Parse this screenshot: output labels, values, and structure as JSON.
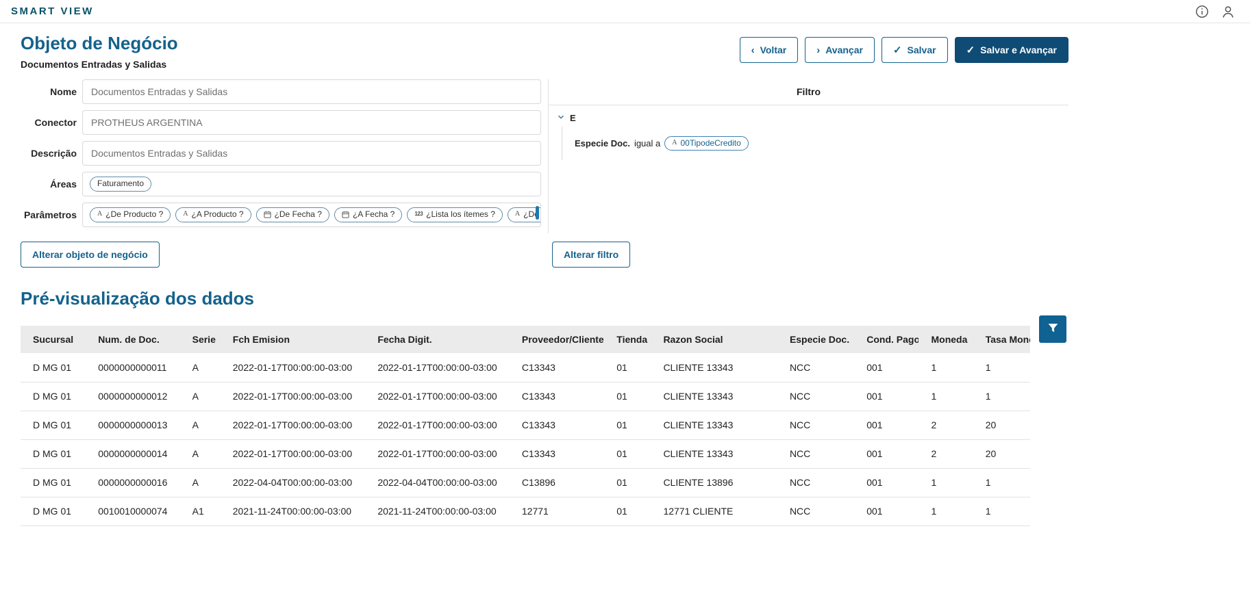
{
  "topbar": {
    "brand": "SMART VIEW",
    "icons": [
      "info",
      "user"
    ]
  },
  "header": {
    "title": "Objeto de Negócio",
    "subtitle": "Documentos Entradas y Salidas",
    "buttons": {
      "back": {
        "icon": "chevron-left",
        "label": "Voltar"
      },
      "next": {
        "icon": "chevron-right",
        "label": "Avançar"
      },
      "save": {
        "icon": "check",
        "label": "Salvar"
      },
      "save_next": {
        "icon": "check",
        "label": "Salvar e Avançar"
      }
    }
  },
  "form": {
    "fields": [
      {
        "label": "Nome",
        "value": "Documentos Entradas y Salidas"
      },
      {
        "label": "Conector",
        "value": "PROTHEUS ARGENTINA"
      },
      {
        "label": "Descrição",
        "value": "Documentos Entradas y Salidas"
      },
      {
        "label": "Áreas",
        "tags": [
          {
            "icon": null,
            "label": "Faturamento"
          }
        ]
      },
      {
        "label": "Parâmetros",
        "tags": [
          {
            "icon": "A",
            "label": "¿De Producto ?"
          },
          {
            "icon": "A",
            "label": "¿A Producto ?"
          },
          {
            "icon": "calendar",
            "label": "¿De Fecha ?"
          },
          {
            "icon": "calendar",
            "label": "¿A Fecha ?"
          },
          {
            "icon": "123",
            "label": "¿Lista los ítemes ?"
          },
          {
            "icon": "A",
            "label": "¿De Grupo ?"
          }
        ]
      }
    ],
    "change_object_button": "Alterar objeto de negócio"
  },
  "filter": {
    "title": "Filtro",
    "group_operator": "E",
    "condition": {
      "field": "Especie Doc.",
      "operator": "igual a",
      "value_icon": "A",
      "value": "00TipodeCredito"
    },
    "change_filter_button": "Alterar filtro"
  },
  "preview": {
    "title": "Pré-visualização dos dados",
    "table": {
      "columns": [
        "Sucursal",
        "Num. de Doc.",
        "Serie",
        "Fch Emision",
        "Fecha Digit.",
        "Proveedor/Cliente",
        "Tienda",
        "Razon Social",
        "Especie Doc.",
        "Cond. Pago",
        "Moneda",
        "Tasa Moneda"
      ],
      "rows": [
        [
          "D MG 01",
          "0000000000011",
          "A",
          "2022-01-17T00:00:00-03:00",
          "2022-01-17T00:00:00-03:00",
          "C13343",
          "01",
          "CLIENTE 13343",
          "NCC",
          "001",
          "1",
          "1"
        ],
        [
          "D MG 01",
          "0000000000012",
          "A",
          "2022-01-17T00:00:00-03:00",
          "2022-01-17T00:00:00-03:00",
          "C13343",
          "01",
          "CLIENTE 13343",
          "NCC",
          "001",
          "1",
          "1"
        ],
        [
          "D MG 01",
          "0000000000013",
          "A",
          "2022-01-17T00:00:00-03:00",
          "2022-01-17T00:00:00-03:00",
          "C13343",
          "01",
          "CLIENTE 13343",
          "NCC",
          "001",
          "2",
          "20"
        ],
        [
          "D MG 01",
          "0000000000014",
          "A",
          "2022-01-17T00:00:00-03:00",
          "2022-01-17T00:00:00-03:00",
          "C13343",
          "01",
          "CLIENTE 13343",
          "NCC",
          "001",
          "2",
          "20"
        ],
        [
          "D MG 01",
          "0000000000016",
          "A",
          "2022-04-04T00:00:00-03:00",
          "2022-04-04T00:00:00-03:00",
          "C13896",
          "01",
          "CLIENTE 13896",
          "NCC",
          "001",
          "1",
          "1"
        ],
        [
          "D MG 01",
          "0010010000074",
          "A1",
          "2021-11-24T00:00:00-03:00",
          "2021-11-24T00:00:00-03:00",
          "12771",
          "01",
          "12771 CLIENTE",
          "NCC",
          "001",
          "1",
          "1"
        ]
      ]
    }
  },
  "colors": {
    "accent": "#14628c",
    "solid_button": "#0e4b75",
    "table_header_bg": "#ebebeb",
    "table_filter_button": "#0f6292",
    "tag_border": "#628ba5",
    "brand": "#0a5268"
  }
}
